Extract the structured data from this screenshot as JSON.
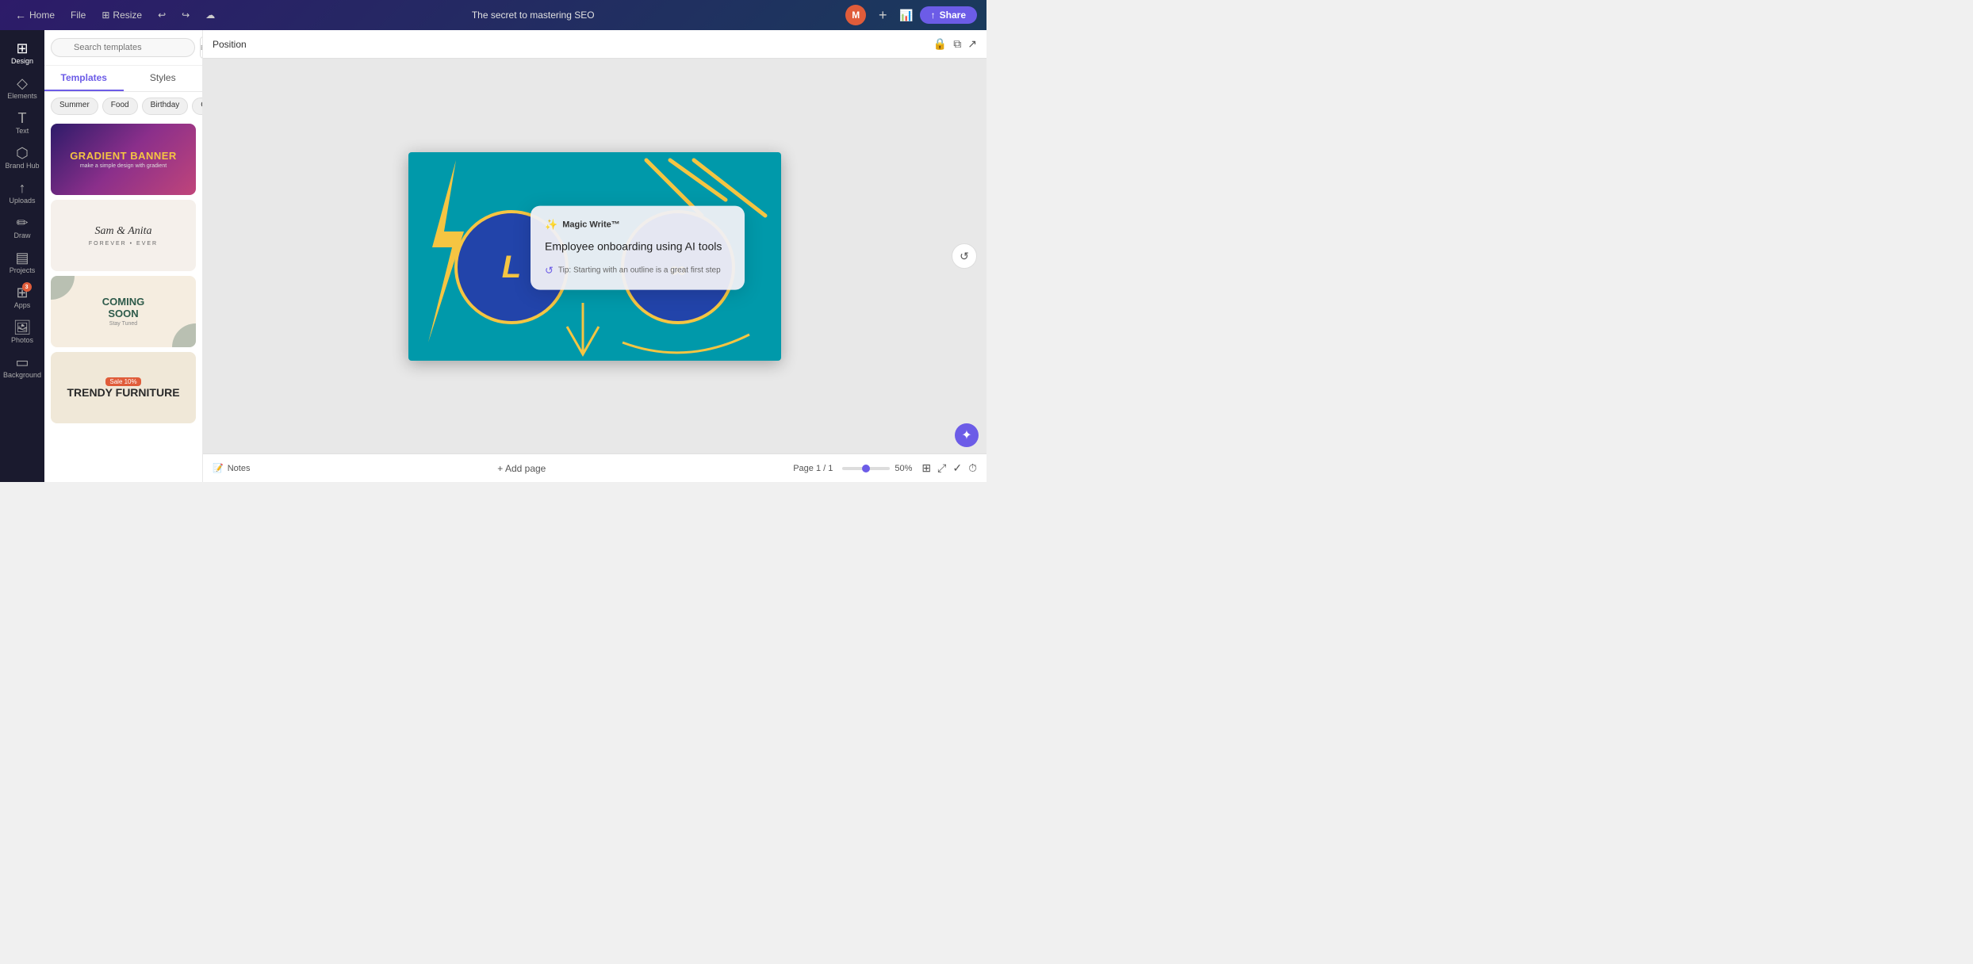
{
  "topbar": {
    "home_label": "Home",
    "file_label": "File",
    "resize_label": "Resize",
    "title": "The secret to mastering SEO",
    "share_label": "Share",
    "avatar_initials": "M"
  },
  "sidebar": {
    "items": [
      {
        "id": "design",
        "label": "Design",
        "icon": "⊞"
      },
      {
        "id": "elements",
        "label": "Elements",
        "icon": "◇"
      },
      {
        "id": "text",
        "label": "Text",
        "icon": "T"
      },
      {
        "id": "brand-hub",
        "label": "Brand Hub",
        "icon": "⬡"
      },
      {
        "id": "uploads",
        "label": "Uploads",
        "icon": "↑"
      },
      {
        "id": "draw",
        "label": "Draw",
        "icon": "✏"
      },
      {
        "id": "projects",
        "label": "Projects",
        "icon": "▤"
      },
      {
        "id": "apps",
        "label": "Apps",
        "icon": "⊞"
      },
      {
        "id": "photos",
        "label": "Photos",
        "icon": "🖼"
      },
      {
        "id": "background",
        "label": "Background",
        "icon": "▭"
      }
    ]
  },
  "left_panel": {
    "search_placeholder": "Search templates",
    "tabs": [
      {
        "id": "templates",
        "label": "Templates"
      },
      {
        "id": "styles",
        "label": "Styles"
      }
    ],
    "active_tab": "templates",
    "filter_chips": [
      {
        "id": "summer",
        "label": "Summer"
      },
      {
        "id": "food",
        "label": "Food"
      },
      {
        "id": "birthday",
        "label": "Birthday"
      },
      {
        "id": "collage",
        "label": "Collage"
      }
    ],
    "templates": [
      {
        "id": "gradient-banner",
        "type": "gradient",
        "title": "GRADIENT BANNER",
        "sub": "make a simple design with gradient"
      },
      {
        "id": "wedding",
        "type": "wedding",
        "name": "Sam & Anita",
        "tagline": "FOREVER • EVER"
      },
      {
        "id": "coming-soon",
        "type": "coming",
        "title1": "COMING",
        "title2": "SOON",
        "sub": "Stay Tuned"
      },
      {
        "id": "furniture",
        "type": "furniture",
        "title": "TRENDY FURNITURE",
        "sale": "Sale 10%"
      }
    ]
  },
  "canvas": {
    "toolbar_label": "Position",
    "add_page_label": "+ Add page",
    "notes_label": "Notes",
    "page_info": "Page 1 / 1",
    "zoom_level": "50%"
  },
  "magic_write": {
    "header": "Magic Write™",
    "content": "Employee onboarding using AI tools",
    "tip_icon": "↺",
    "tip_text": "Tip: Starting with an outline is a great first step"
  },
  "notifications": {
    "count": "3"
  }
}
